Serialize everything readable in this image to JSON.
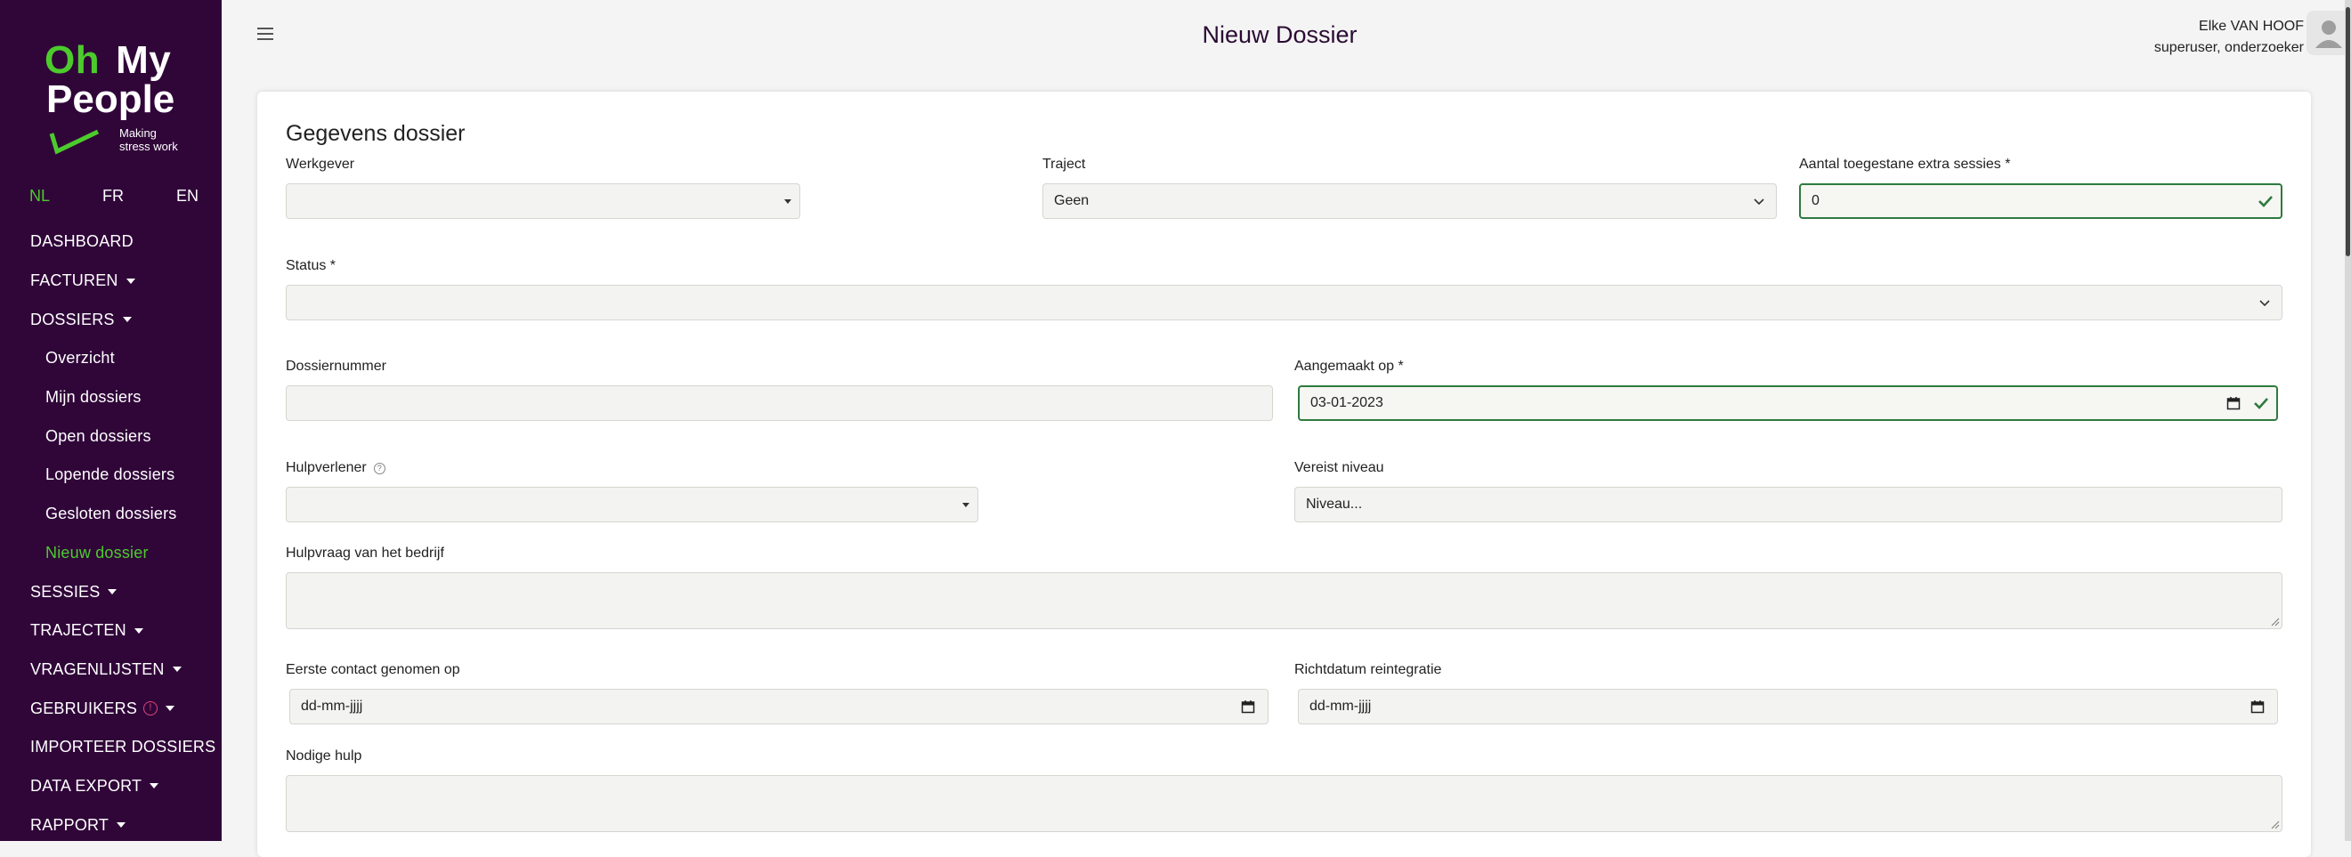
{
  "brand": {
    "line1_a": "Oh",
    "line1_b": "My",
    "line2": "People",
    "tagline_1": "Making",
    "tagline_2": "stress work",
    "accent": "#4ccb2c",
    "sidebar_bg": "#300639"
  },
  "languages": [
    {
      "label": "NL",
      "active": true
    },
    {
      "label": "FR",
      "active": false
    },
    {
      "label": "EN",
      "active": false
    }
  ],
  "nav": [
    {
      "label": "DASHBOARD",
      "caret": false
    },
    {
      "label": "FACTUREN",
      "caret": true
    },
    {
      "label": "DOSSIERS",
      "caret": true
    },
    {
      "label": "Overzicht",
      "sub": true
    },
    {
      "label": "Mijn dossiers",
      "sub": true
    },
    {
      "label": "Open dossiers",
      "sub": true
    },
    {
      "label": "Lopende dossiers",
      "sub": true
    },
    {
      "label": "Gesloten dossiers",
      "sub": true
    },
    {
      "label": "Nieuw dossier",
      "sub": true,
      "active": true
    },
    {
      "label": "SESSIES",
      "caret": true
    },
    {
      "label": "TRAJECTEN",
      "caret": true
    },
    {
      "label": "VRAGENLIJSTEN",
      "caret": true
    },
    {
      "label": "GEBRUIKERS",
      "caret": true,
      "warning": true
    },
    {
      "label": "IMPORTEER DOSSIERS",
      "caret": false
    },
    {
      "label": "DATA EXPORT",
      "caret": true
    },
    {
      "label": "RAPPORT",
      "caret": true
    }
  ],
  "header": {
    "title": "Nieuw Dossier",
    "user_name": "Elke VAN HOOF",
    "user_role": "superuser, onderzoeker"
  },
  "form": {
    "title": "Gegevens dossier",
    "werkgever": {
      "label": "Werkgever",
      "value": ""
    },
    "traject": {
      "label": "Traject",
      "value": "Geen"
    },
    "extra_sessies": {
      "label": "Aantal toegestane extra sessies *",
      "value": "0"
    },
    "status": {
      "label": "Status *",
      "value": ""
    },
    "dossiernummer": {
      "label": "Dossiernummer",
      "value": ""
    },
    "aangemaakt_op": {
      "label": "Aangemaakt op *",
      "value": "03-01-2023"
    },
    "hulpverlener": {
      "label": "Hulpverlener",
      "value": ""
    },
    "vereist_niveau": {
      "label": "Vereist niveau",
      "value": "Niveau..."
    },
    "hulpvraag": {
      "label": "Hulpvraag van het bedrijf",
      "value": ""
    },
    "eerste_contact": {
      "label": "Eerste contact genomen op",
      "value": "dd-mm-jjjj"
    },
    "richtdatum": {
      "label": "Richtdatum reintegratie",
      "value": "dd-mm-jjjj"
    },
    "nodige_hulp": {
      "label": "Nodige hulp",
      "value": ""
    }
  }
}
